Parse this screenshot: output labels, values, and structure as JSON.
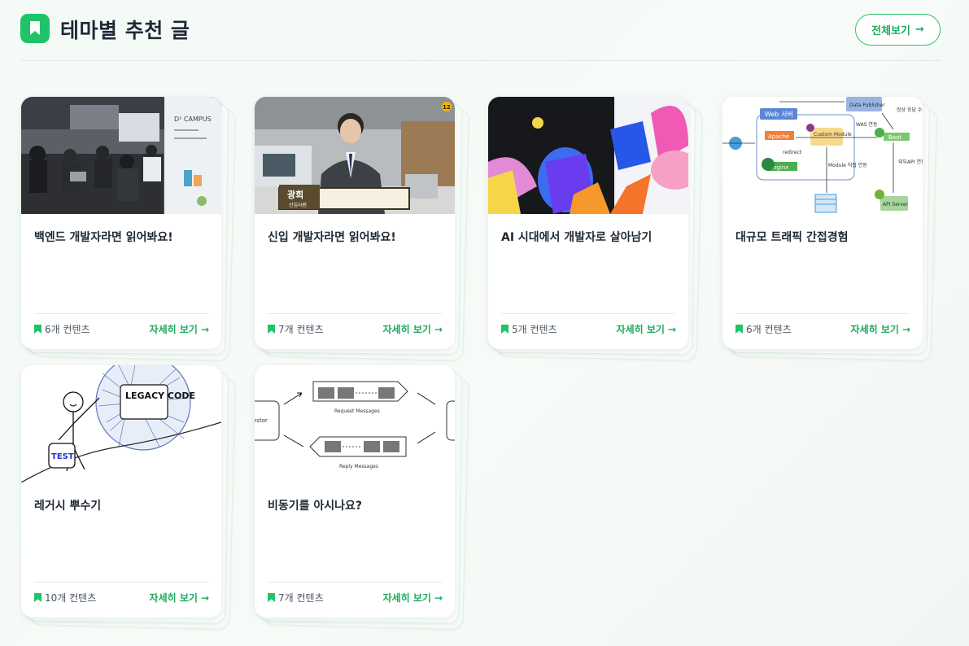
{
  "header": {
    "title": "테마별 추천 글",
    "view_all_label": "전체보기",
    "view_all_arrow": "→"
  },
  "colors": {
    "accent": "#1fc36a",
    "text": "#1f2933",
    "link": "#1faa5c"
  },
  "cards": [
    {
      "title": "백엔드 개발자라면 읽어봐요!",
      "count": "6개 컨텐츠",
      "detail": "자세히 보기",
      "arrow": "→",
      "thumb_text": "D² CAMPUS"
    },
    {
      "title": "신입 개발자라면 읽어봐요!",
      "count": "7개 컨텐츠",
      "detail": "자세히 보기",
      "arrow": "→",
      "thumb_caption": "광희",
      "thumb_sub": "신입사원",
      "thumb_badge": "12"
    },
    {
      "title": "AI 시대에서 개발자로 살아남기",
      "count": "5개 컨텐츠",
      "detail": "자세히 보기",
      "arrow": "→"
    },
    {
      "title": "대규모 트래픽 간접경험",
      "count": "6개 컨텐츠",
      "detail": "자세히 보기",
      "arrow": "→",
      "thumb_labels": {
        "web": "Web 서버",
        "apache": "Apache",
        "nginx": "nginx",
        "custom": "Custom Module",
        "boot": "Boot",
        "data": "Data Publisher",
        "api": "API Server",
        "redirect": "redirect",
        "was": "WAS 연동",
        "module": "Module 직접 연동",
        "ext": "외부API 연동 유입",
        "normal": "정상 응답 수집"
      }
    },
    {
      "title": "레거시 뿌수기",
      "count": "10개 컨텐츠",
      "detail": "자세히 보기",
      "arrow": "→",
      "thumb_legacy": "LEGACY CODE",
      "thumb_test": "TEST"
    },
    {
      "title": "비동기를 아시나요?",
      "count": "7개 컨텐츠",
      "detail": "자세히 보기",
      "arrow": "→",
      "thumb_request": "Request Messages",
      "thumb_reply": "Reply Messages",
      "thumb_left": "estor"
    }
  ]
}
